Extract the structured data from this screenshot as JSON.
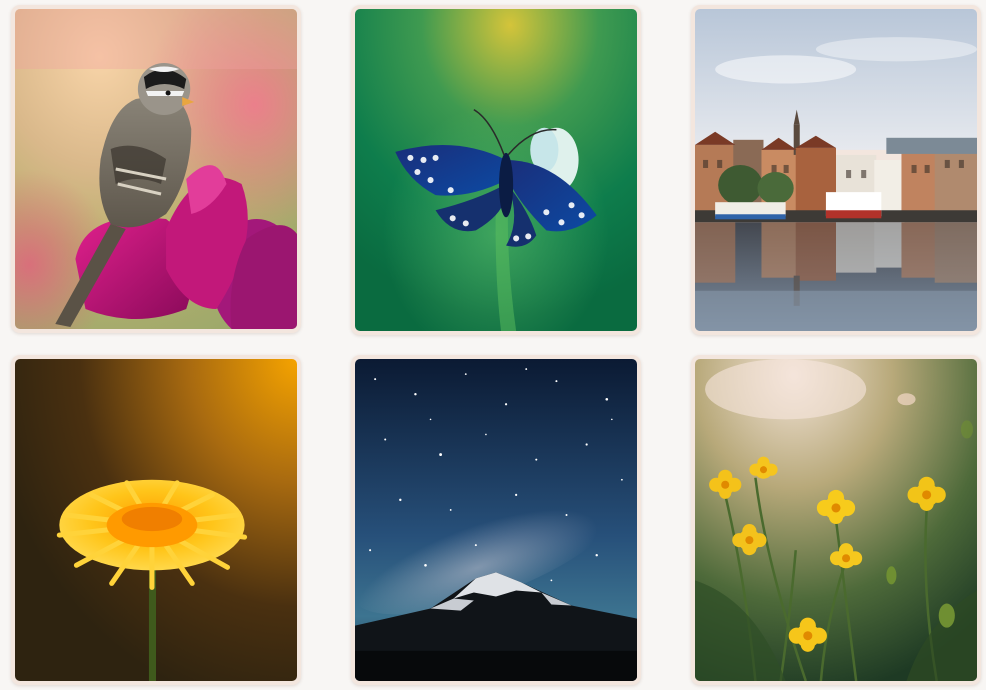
{
  "gallery": {
    "photos": [
      {
        "subject": "bird-on-magenta-tulip",
        "accent": "#c2187a"
      },
      {
        "subject": "blue-butterfly-on-green",
        "accent": "#1d4fa8"
      },
      {
        "subject": "harbour-town-reflection",
        "accent": "#b25a3c"
      },
      {
        "subject": "yellow-dandelion",
        "accent": "#f2a900"
      },
      {
        "subject": "milky-way-over-mountain",
        "accent": "#2a4a78"
      },
      {
        "subject": "yellow-wildflowers",
        "accent": "#e8c21c"
      }
    ]
  }
}
